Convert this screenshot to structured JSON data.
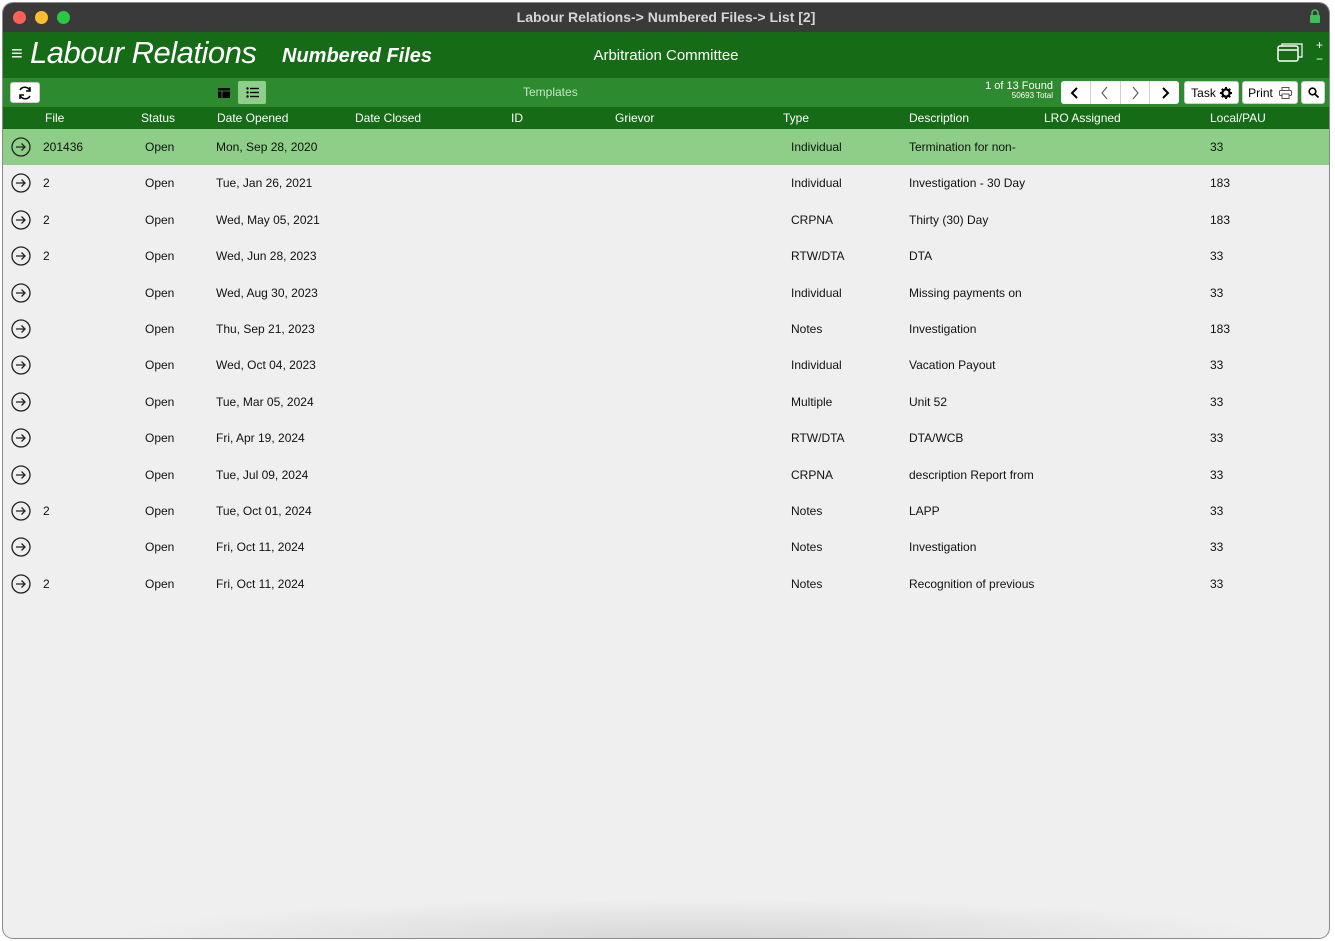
{
  "window": {
    "title": "Labour Relations-> Numbered Files-> List [2]"
  },
  "header": {
    "app_title": "Labour Relations",
    "module_title": "Numbered Files",
    "committee": "Arbitration Committee",
    "plus": "+",
    "minus": "−"
  },
  "toolbar": {
    "templates_label": "Templates",
    "found_text": "1 of 13 Found",
    "total_text": "50693 Total",
    "task_label": "Task",
    "print_label": "Print"
  },
  "columns": {
    "file": "File",
    "status": "Status",
    "date_opened": "Date Opened",
    "date_closed": "Date Closed",
    "id": "ID",
    "grievor": "Grievor",
    "type": "Type",
    "description": "Description",
    "lro_assigned": "LRO Assigned",
    "local_pau": "Local/PAU"
  },
  "rows": [
    {
      "file": "201436",
      "status": "Open",
      "date_opened": "Mon, Sep 28, 2020",
      "type": "Individual",
      "description": "Termination for non-",
      "local": "33"
    },
    {
      "file": "2",
      "status": "Open",
      "date_opened": "Tue, Jan 26, 2021",
      "type": "Individual",
      "description": "Investigation - 30 Day",
      "local": "183"
    },
    {
      "file": "2",
      "status": "Open",
      "date_opened": "Wed, May 05, 2021",
      "type": "CRPNA",
      "description": "Thirty (30) Day",
      "local": "183"
    },
    {
      "file": "2",
      "status": "Open",
      "date_opened": "Wed, Jun 28, 2023",
      "type": "RTW/DTA",
      "description": "DTA",
      "local": "33"
    },
    {
      "file": "",
      "status": "Open",
      "date_opened": "Wed, Aug 30, 2023",
      "type": "Individual",
      "description": "Missing payments on",
      "local": "33"
    },
    {
      "file": "",
      "status": "Open",
      "date_opened": "Thu, Sep 21, 2023",
      "type": "Notes",
      "description": "Investigation",
      "local": "183"
    },
    {
      "file": "",
      "status": "Open",
      "date_opened": "Wed, Oct 04, 2023",
      "type": "Individual",
      "description": "Vacation Payout",
      "local": "33"
    },
    {
      "file": "",
      "status": "Open",
      "date_opened": "Tue, Mar 05, 2024",
      "type": "Multiple",
      "description": "Unit 52",
      "local": "33"
    },
    {
      "file": "",
      "status": "Open",
      "date_opened": "Fri, Apr 19, 2024",
      "type": "RTW/DTA",
      "description": "DTA/WCB",
      "local": "33"
    },
    {
      "file": "",
      "status": "Open",
      "date_opened": "Tue, Jul 09, 2024",
      "type": "CRPNA",
      "description": "description Report from",
      "local": "33"
    },
    {
      "file": "2",
      "status": "Open",
      "date_opened": "Tue, Oct 01, 2024",
      "type": "Notes",
      "description": "LAPP",
      "local": "33"
    },
    {
      "file": "",
      "status": "Open",
      "date_opened": "Fri, Oct 11, 2024",
      "type": "Notes",
      "description": "Investigation",
      "local": "33"
    },
    {
      "file": "2",
      "status": "Open",
      "date_opened": "Fri, Oct 11, 2024",
      "type": "Notes",
      "description": "Recognition of previous",
      "local": "33"
    }
  ],
  "colors": {
    "header_green": "#156b16",
    "toolbar_green": "#2d8a2f",
    "selected_row": "#8ece88"
  },
  "icons": {
    "refresh": "refresh-icon",
    "form_view": "form-view-icon",
    "list_view": "list-view-icon",
    "first": "first-record-icon",
    "prev": "previous-record-icon",
    "next": "next-record-icon",
    "last": "last-record-icon",
    "gear": "gear-icon",
    "printer": "printer-icon",
    "search": "search-icon",
    "go": "go-arrow-icon"
  }
}
